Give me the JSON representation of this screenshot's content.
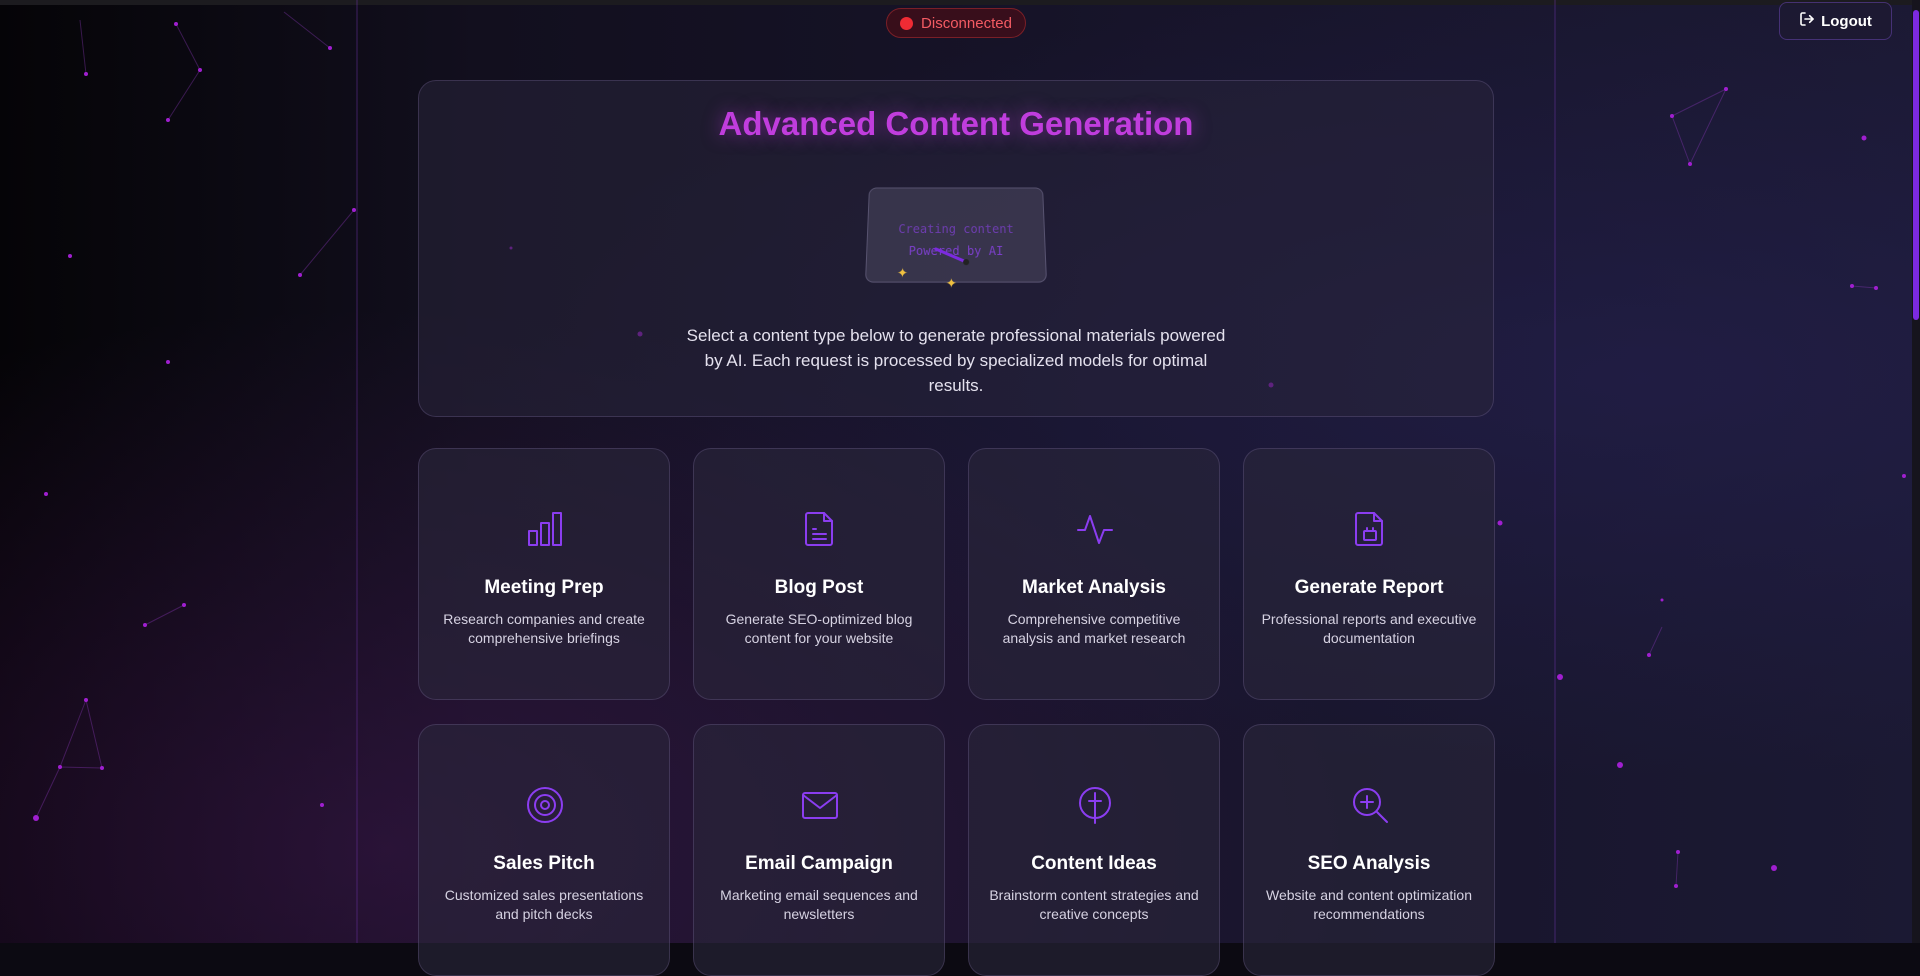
{
  "status": {
    "label": "Disconnected",
    "color": "#ef2b34"
  },
  "header": {
    "logout_label": "Logout"
  },
  "hero": {
    "title": "Advanced Content Generation",
    "laptop_text_1": "Creating content",
    "laptop_text_2": "Powered by AI",
    "description": "Select a content type below to generate professional materials powered by AI. Each request is processed by specialized models for optimal results."
  },
  "cards": [
    {
      "title": "Meeting Prep",
      "description": "Research companies and create comprehensive briefings",
      "icon": "bar-chart-icon"
    },
    {
      "title": "Blog Post",
      "description": "Generate SEO-optimized blog content for your website",
      "icon": "document-icon"
    },
    {
      "title": "Market Analysis",
      "description": "Comprehensive competitive analysis and market research",
      "icon": "pulse-icon"
    },
    {
      "title": "Generate Report",
      "description": "Professional reports and executive documentation",
      "icon": "report-icon"
    },
    {
      "title": "Sales Pitch",
      "description": "Customized sales presentations and pitch decks",
      "icon": "target-icon"
    },
    {
      "title": "Email Campaign",
      "description": "Marketing email sequences and newsletters",
      "icon": "mail-icon"
    },
    {
      "title": "Content Ideas",
      "description": "Brainstorm content strategies and creative concepts",
      "icon": "lightbulb-icon"
    },
    {
      "title": "SEO Analysis",
      "description": "Website and content optimization recommendations",
      "icon": "search-plus-icon"
    }
  ],
  "colors": {
    "accent": "#8b3df0",
    "title": "#c03ddd",
    "background": "#0c0a12"
  }
}
